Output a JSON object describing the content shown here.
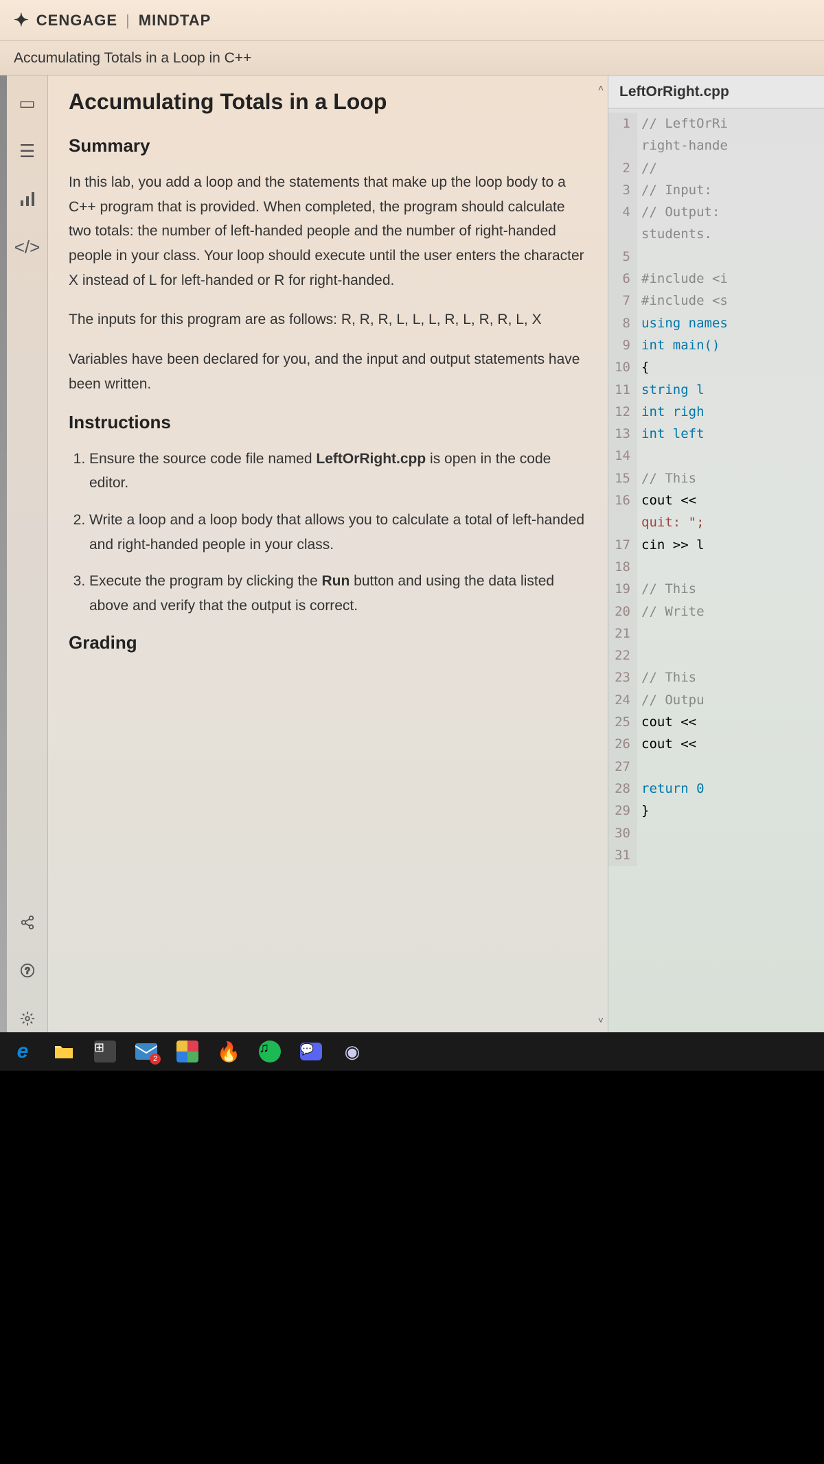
{
  "header": {
    "brand1": "CENGAGE",
    "brand2": "MINDTAP"
  },
  "subtitle": "Accumulating Totals in a Loop in C++",
  "content": {
    "title": "Accumulating Totals in a Loop",
    "summary_heading": "Summary",
    "summary_p1": "In this lab, you add a loop and the statements that make up the loop body to a C++ program that is provided. When completed, the program should calculate two totals: the number of left-handed people and the number of right-handed people in your class. Your loop should execute until the user enters the character X instead of L for left-handed or R for right-handed.",
    "summary_p2": "The inputs for this program are as follows: R, R, R, L, L, L, R, L, R, R, L, X",
    "summary_p3": "Variables have been declared for you, and the input and output statements have been written.",
    "instructions_heading": "Instructions",
    "step1_pre": "Ensure the source code file named ",
    "step1_file": "LeftOrRight.cpp",
    "step1_post": " is open in the code editor.",
    "step2": "Write a loop and a loop body that allows you to calculate a total of left-handed and right-handed people in your class.",
    "step3_pre": "Execute the program by clicking the ",
    "step3_bold": "Run",
    "step3_post": " button and using the data listed above and verify that the output is correct.",
    "grading_heading": "Grading"
  },
  "editor": {
    "tab": "LeftOrRight.cpp",
    "lines": [
      {
        "n": 1,
        "class": "c-comment",
        "text": "// LeftOrRi"
      },
      {
        "n": "",
        "class": "c-comment",
        "text": "right-hande"
      },
      {
        "n": 2,
        "class": "c-comment",
        "text": "//"
      },
      {
        "n": 3,
        "class": "c-comment",
        "text": "// Input:"
      },
      {
        "n": 4,
        "class": "c-comment",
        "text": "// Output:"
      },
      {
        "n": "",
        "class": "c-comment",
        "text": "students."
      },
      {
        "n": 5,
        "class": "",
        "text": ""
      },
      {
        "n": 6,
        "class": "c-pp",
        "text": "#include <i"
      },
      {
        "n": 7,
        "class": "c-pp",
        "text": "#include <s"
      },
      {
        "n": 8,
        "class": "c-kw",
        "text": "using names"
      },
      {
        "n": 9,
        "class": "c-kw",
        "text": "int main()"
      },
      {
        "n": 10,
        "class": "",
        "text": "{"
      },
      {
        "n": 11,
        "class": "c-type",
        "text": "   string l"
      },
      {
        "n": 12,
        "class": "c-type",
        "text": "   int righ"
      },
      {
        "n": 13,
        "class": "c-type",
        "text": "   int left"
      },
      {
        "n": 14,
        "class": "",
        "text": ""
      },
      {
        "n": 15,
        "class": "c-comment",
        "text": "   // This"
      },
      {
        "n": 16,
        "class": "",
        "text": "   cout <<"
      },
      {
        "n": "",
        "class": "c-str",
        "text": "quit: \";"
      },
      {
        "n": 17,
        "class": "",
        "text": "   cin >> l"
      },
      {
        "n": 18,
        "class": "",
        "text": ""
      },
      {
        "n": 19,
        "class": "c-comment",
        "text": "   // This"
      },
      {
        "n": 20,
        "class": "c-comment",
        "text": "   // Write"
      },
      {
        "n": 21,
        "class": "",
        "text": ""
      },
      {
        "n": 22,
        "class": "",
        "text": ""
      },
      {
        "n": 23,
        "class": "c-comment",
        "text": "   // This"
      },
      {
        "n": 24,
        "class": "c-comment",
        "text": "   // Outpu"
      },
      {
        "n": 25,
        "class": "",
        "text": "   cout <<"
      },
      {
        "n": 26,
        "class": "",
        "text": "   cout <<"
      },
      {
        "n": 27,
        "class": "",
        "text": ""
      },
      {
        "n": 28,
        "class": "c-kw",
        "text": "   return 0"
      },
      {
        "n": 29,
        "class": "",
        "text": "}"
      },
      {
        "n": 30,
        "class": "",
        "text": ""
      },
      {
        "n": 31,
        "class": "",
        "text": ""
      }
    ]
  },
  "taskbar": {
    "mail_badge": "2"
  }
}
